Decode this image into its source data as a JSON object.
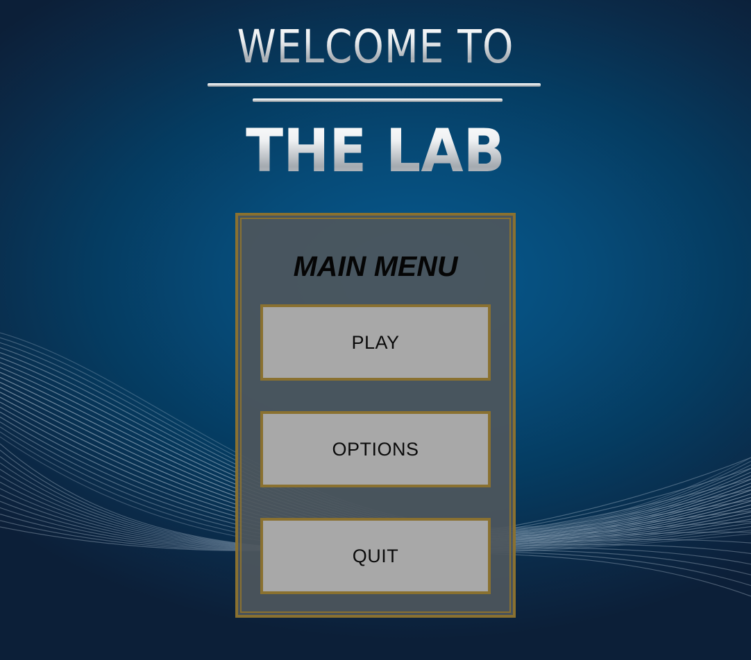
{
  "header": {
    "welcome_text": "WELCOME TO",
    "game_title": "THE LAB"
  },
  "main_menu": {
    "title": "MAIN MENU",
    "buttons": [
      {
        "label": "PLAY"
      },
      {
        "label": "OPTIONS"
      },
      {
        "label": "QUIT"
      }
    ]
  },
  "colors": {
    "background_center": "#075a90",
    "background_edge": "#0c1f38",
    "panel_fill": "#4e565c",
    "gold_border": "#8a7130",
    "button_fill": "#a8a8a8",
    "title_silver": "#e8ebee"
  }
}
